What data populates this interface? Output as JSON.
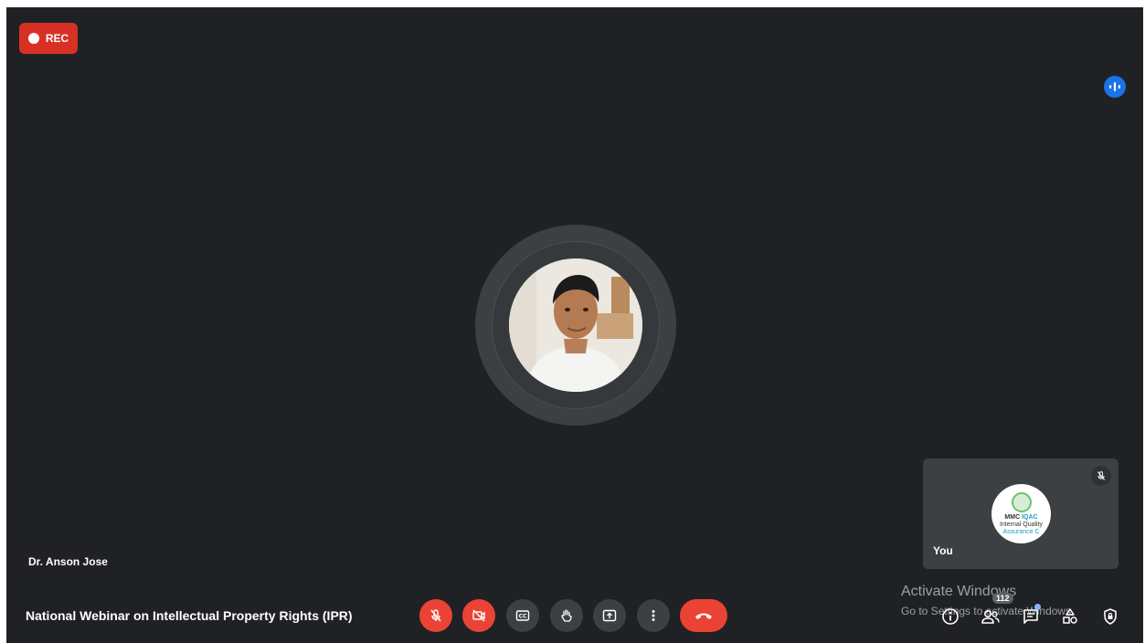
{
  "recording": {
    "label": "REC"
  },
  "main_speaker": {
    "name": "Dr. Anson Jose"
  },
  "meeting": {
    "title": "National Webinar on Intellectual Property Rights (IPR)"
  },
  "self_tile": {
    "label": "You",
    "logo_line1": "MMC",
    "logo_line1_accent": "IQAC",
    "logo_line2": "Internal Quality",
    "logo_line3": "Assurance C"
  },
  "people": {
    "count": "112"
  },
  "watermark": {
    "title": "Activate Windows",
    "subtitle": "Go to Settings to activate Windows."
  },
  "toolbar": {
    "mic": "mic-off-icon",
    "camera": "camera-off-icon",
    "captions": "closed-captions-icon",
    "hand": "raise-hand-icon",
    "present": "present-screen-icon",
    "more": "more-vert-icon",
    "leave": "call-end-icon"
  },
  "colors": {
    "stage_bg": "#202124",
    "tile_bg": "#3c4043",
    "danger": "#ea4335",
    "accent_blue": "#1a73e8"
  }
}
